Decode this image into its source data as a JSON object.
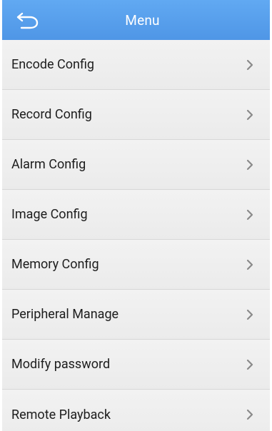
{
  "header": {
    "title": "Menu",
    "back_icon": "back-arrow-icon",
    "background_color": "#58a0ee"
  },
  "menu": {
    "items": [
      {
        "label": "Encode Config",
        "icon": "chevron-right-icon"
      },
      {
        "label": "Record Config",
        "icon": "chevron-right-icon"
      },
      {
        "label": "Alarm Config",
        "icon": "chevron-right-icon"
      },
      {
        "label": "Image Config",
        "icon": "chevron-right-icon"
      },
      {
        "label": "Memory Config",
        "icon": "chevron-right-icon"
      },
      {
        "label": "Peripheral Manage",
        "icon": "chevron-right-icon"
      },
      {
        "label": "Modify password",
        "icon": "chevron-right-icon"
      },
      {
        "label": "Remote Playback",
        "icon": "chevron-right-icon"
      }
    ]
  },
  "colors": {
    "item_background": "#efefef",
    "separator": "#d7d7d7",
    "text": "#1d1d1d",
    "chevron": "#8a8a8a"
  }
}
